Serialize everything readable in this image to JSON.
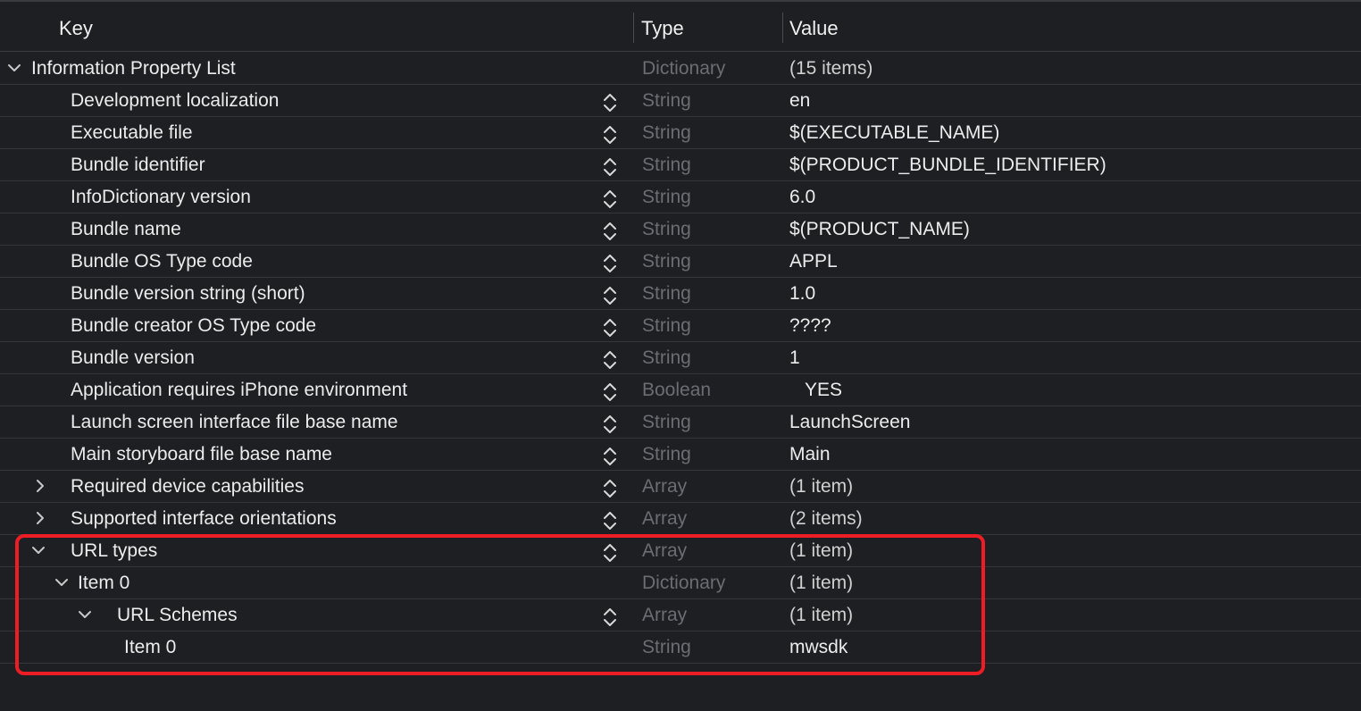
{
  "header": {
    "key_label": "Key",
    "type_label": "Type",
    "value_label": "Value"
  },
  "root": {
    "key": "Information Property List",
    "type": "Dictionary",
    "value": "(15 items)"
  },
  "rows": [
    {
      "key": "Development localization",
      "type": "String",
      "value": "en"
    },
    {
      "key": "Executable file",
      "type": "String",
      "value": "$(EXECUTABLE_NAME)"
    },
    {
      "key": "Bundle identifier",
      "type": "String",
      "value": "$(PRODUCT_BUNDLE_IDENTIFIER)"
    },
    {
      "key": "InfoDictionary version",
      "type": "String",
      "value": "6.0"
    },
    {
      "key": "Bundle name",
      "type": "String",
      "value": "$(PRODUCT_NAME)"
    },
    {
      "key": "Bundle OS Type code",
      "type": "String",
      "value": "APPL"
    },
    {
      "key": "Bundle version string (short)",
      "type": "String",
      "value": "1.0"
    },
    {
      "key": "Bundle creator OS Type code",
      "type": "String",
      "value": "????"
    },
    {
      "key": "Bundle version",
      "type": "String",
      "value": "1"
    },
    {
      "key": "Application requires iPhone environment",
      "type": "Boolean",
      "value": "YES"
    },
    {
      "key": "Launch screen interface file base name",
      "type": "String",
      "value": "LaunchScreen"
    },
    {
      "key": "Main storyboard file base name",
      "type": "String",
      "value": "Main"
    },
    {
      "key": "Required device capabilities",
      "type": "Array",
      "value": "(1 item)"
    },
    {
      "key": "Supported interface orientations",
      "type": "Array",
      "value": "(2 items)"
    },
    {
      "key": "URL types",
      "type": "Array",
      "value": "(1 item)"
    },
    {
      "key": "Item 0",
      "type": "Dictionary",
      "value": "(1 item)"
    },
    {
      "key": "URL Schemes",
      "type": "Array",
      "value": "(1 item)"
    },
    {
      "key": "Item 0",
      "type": "String",
      "value": "mwsdk"
    }
  ],
  "colors": {
    "background": "#1e1f22",
    "highlight": "#ee1c25",
    "type_text": "#6c6d72"
  }
}
